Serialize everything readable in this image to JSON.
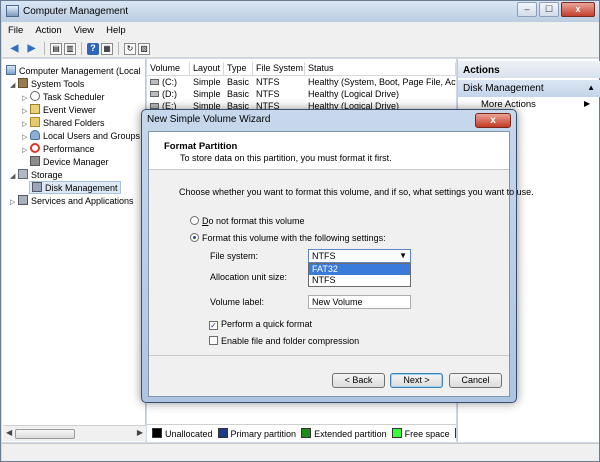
{
  "window": {
    "title": "Computer Management",
    "min": "–",
    "max": "☐",
    "close": "x"
  },
  "menu": [
    "File",
    "Action",
    "View",
    "Help"
  ],
  "tree": {
    "root": "Computer Management (Local",
    "system_tools": "System Tools",
    "task_scheduler": "Task Scheduler",
    "event_viewer": "Event Viewer",
    "shared_folders": "Shared Folders",
    "local_users": "Local Users and Groups",
    "performance": "Performance",
    "device_manager": "Device Manager",
    "storage": "Storage",
    "disk_management": "Disk Management",
    "services": "Services and Applications"
  },
  "volumes": {
    "columns": [
      "Volume",
      "Layout",
      "Type",
      "File System",
      "Status"
    ],
    "rows": [
      [
        "(C:)",
        "Simple",
        "Basic",
        "NTFS",
        "Healthy (System, Boot, Page File, Acti"
      ],
      [
        "(D:)",
        "Simple",
        "Basic",
        "NTFS",
        "Healthy (Logical Drive)"
      ],
      [
        "(E:)",
        "Simple",
        "Basic",
        "NTFS",
        "Healthy (Logical Drive)"
      ]
    ]
  },
  "legend": [
    {
      "label": "Unallocated",
      "color": "#000000"
    },
    {
      "label": "Primary partition",
      "color": "#1a3a8c"
    },
    {
      "label": "Extended partition",
      "color": "#1e8a1e"
    },
    {
      "label": "Free space",
      "color": "#3cff3c"
    },
    {
      "label": "L",
      "color": "#1a1aff"
    }
  ],
  "actions": {
    "header": "Actions",
    "section": "Disk Management",
    "more": "More Actions"
  },
  "dialog": {
    "title": "New Simple Volume Wizard",
    "close": "x",
    "header_title": "Format Partition",
    "header_subtitle": "To store data on this partition, you must format it first.",
    "prompt": "Choose whether you want to format this volume, and if so, what settings you want to use.",
    "opt_no_format_u": "D",
    "opt_no_format_rest": "o not format this volume",
    "opt_format": "Format this volume with the following settings:",
    "fs_label": "File system:",
    "fs_value": "NTFS",
    "fs_options": [
      "FAT32",
      "NTFS"
    ],
    "alloc_label": "Allocation unit size:",
    "vol_label": "Volume label:",
    "vol_value": "New Volume",
    "quick_format": "Perform a quick format",
    "quick_format_checked": true,
    "compression": "Enable file and folder compression",
    "compression_checked": false,
    "back": "< Back",
    "next": "Next >",
    "cancel": "Cancel"
  }
}
